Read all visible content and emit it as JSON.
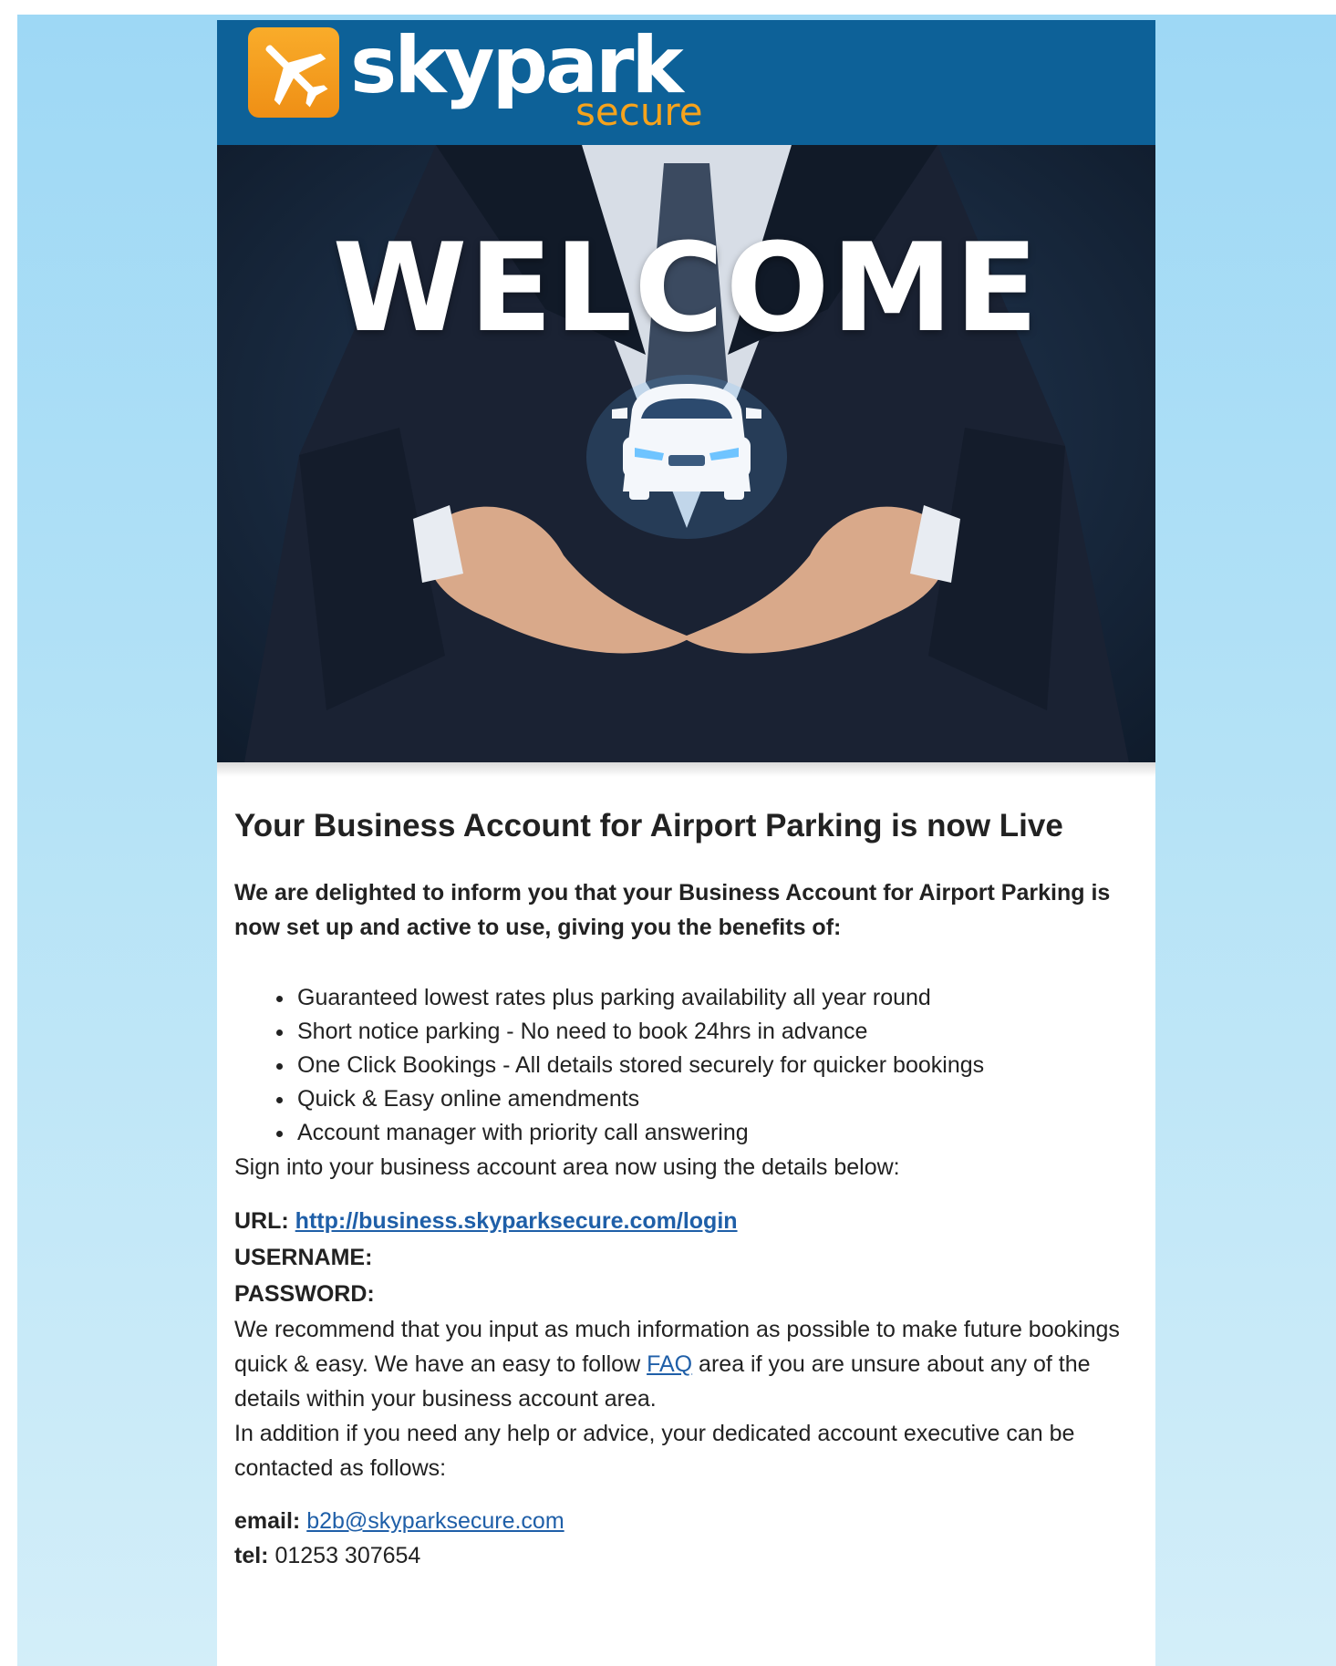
{
  "brand": {
    "name": "skypark",
    "tagline": "secure",
    "logo_icon": "airplane-icon",
    "header_color": "#0d6198",
    "accent_color": "#f6a31c"
  },
  "hero": {
    "title": "WELCOME",
    "image": "businessman-holding-car-icon"
  },
  "body": {
    "heading": "Your Business Account for Airport Parking is now Live",
    "intro": "We are delighted to inform you that your Business Account for Airport Parking is now set up and active to use, giving you the benefits of:",
    "benefits": [
      "Guaranteed lowest rates plus parking availability all year round",
      "Short notice parking - No need to book 24hrs in advance",
      "One Click Bookings - All details stored securely for quicker bookings",
      "Quick & Easy online amendments",
      "Account manager with priority call answering"
    ],
    "signin_text": "Sign into your business account area now using the details below:",
    "credentials": {
      "url_label": "URL:",
      "url": "http://business.skyparksecure.com/login",
      "username_label": "USERNAME:",
      "password_label": "PASSWORD:"
    },
    "recommend": {
      "before_link": "We recommend that you input as much information as possible to make future bookings quick & easy. We have an easy to follow ",
      "link": "FAQ",
      "after_link": " area if you are unsure about any of the details within your business account area."
    },
    "addition": "In addition if you need any help or advice, your dedicated account executive can be contacted as follows:",
    "contact": {
      "email_label": "email:",
      "email": "b2b@skyparksecure.com",
      "tel_label": "tel:",
      "tel": "01253 307654"
    }
  }
}
